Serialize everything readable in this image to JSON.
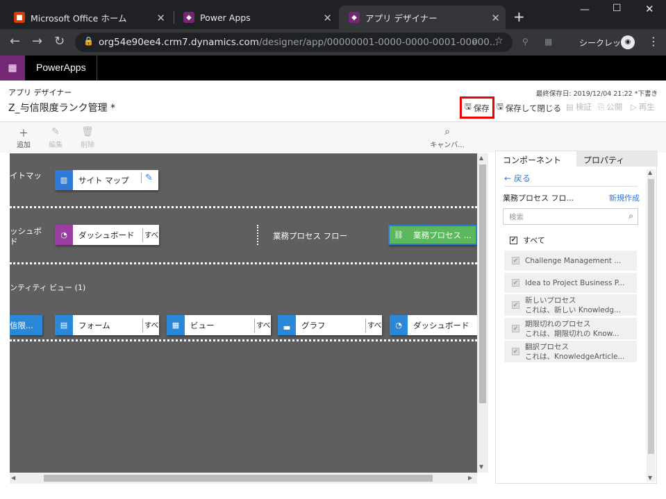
{
  "browser": {
    "tabs": [
      {
        "label": "Microsoft Office ホーム",
        "icon": "office-icon"
      },
      {
        "label": "Power Apps",
        "icon": "powerapps-icon"
      },
      {
        "label": "アプリ デザイナー",
        "icon": "powerapps-icon"
      }
    ],
    "url_host": "org54e90ee4.crm7.dynamics.com",
    "url_path": "/designer/app/00000001-0000-0000-0001-00000...",
    "incognito_label": "シークレット"
  },
  "suite": {
    "title": "PowerApps"
  },
  "header": {
    "subtitle": "アプリ デザイナー",
    "app_name": "Z_与信限度ランク管理 *",
    "last_saved": "最終保存日: 2019/12/04 21:22 *下書き",
    "save": "保存",
    "save_close": "保存して閉じる",
    "validate": "検証",
    "publish": "公開",
    "play": "再生"
  },
  "toolbar": {
    "add": "追加",
    "edit": "編集",
    "delete": "削除",
    "canvas": "キャンバ..."
  },
  "canvas": {
    "sitemap_label": "イトマッ",
    "sitemap_tile": "サイト マップ",
    "dashboard_label_1": "ッシュボ",
    "dashboard_label_2": "ド",
    "dashboard_tile": "ダッシュボード",
    "all": "すべて",
    "bpf_label": "業務プロセス フロー",
    "bpf_tile": "業務プロセス ...",
    "entity_view_label": "ンティティ ビュー (1)",
    "entity_tile": "信限...",
    "form_tile": "フォーム",
    "view_tile": "ビュー",
    "chart_tile": "グラフ",
    "dash_tile2": "ダッシュボード"
  },
  "panel": {
    "tab_components": "コンポーネント",
    "tab_properties": "プロパティ",
    "back": "戻る",
    "section": "業務プロセス フロ...",
    "new": "新規作成",
    "search_placeholder": "検索",
    "all": "すべて",
    "items": [
      {
        "title": "Challenge Management ...",
        "desc": ""
      },
      {
        "title": "Idea to Project Business P...",
        "desc": ""
      },
      {
        "title": "新しいプロセス",
        "desc": "これは、新しい Knowledg..."
      },
      {
        "title": "期限切れのプロセス",
        "desc": "これは、期限切れの Know..."
      },
      {
        "title": "翻訳プロセス",
        "desc": "これは、KnowledgeArticle..."
      }
    ]
  }
}
